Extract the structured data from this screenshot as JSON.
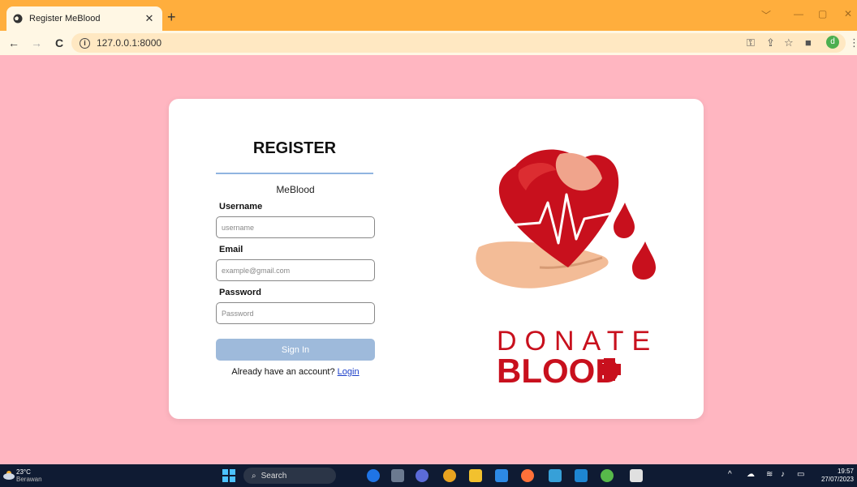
{
  "browser": {
    "tab_title": "Register MeBlood",
    "url": "127.0.0.1:8000",
    "profile_initial": "d"
  },
  "form": {
    "title": "REGISTER",
    "brand": "MeBlood",
    "username_label": "Username",
    "username_placeholder": "username",
    "email_label": "Email",
    "email_placeholder": "example@gmail.com",
    "password_label": "Password",
    "password_placeholder": "Password",
    "submit_label": "Sign In",
    "account_prompt": "Already have an account?",
    "login_link": "Login"
  },
  "illustration": {
    "line1": "DONATE",
    "line2": "BLOOD"
  },
  "taskbar": {
    "temperature": "23°C",
    "weather": "Berawan",
    "search_label": "Search",
    "time": "19:57",
    "date": "27/07/2023"
  },
  "colors": {
    "page_bg": "#ffb6c1",
    "tabbar": "#ffae3d",
    "button": "#9ebadb",
    "blood_red": "#c8101d"
  }
}
